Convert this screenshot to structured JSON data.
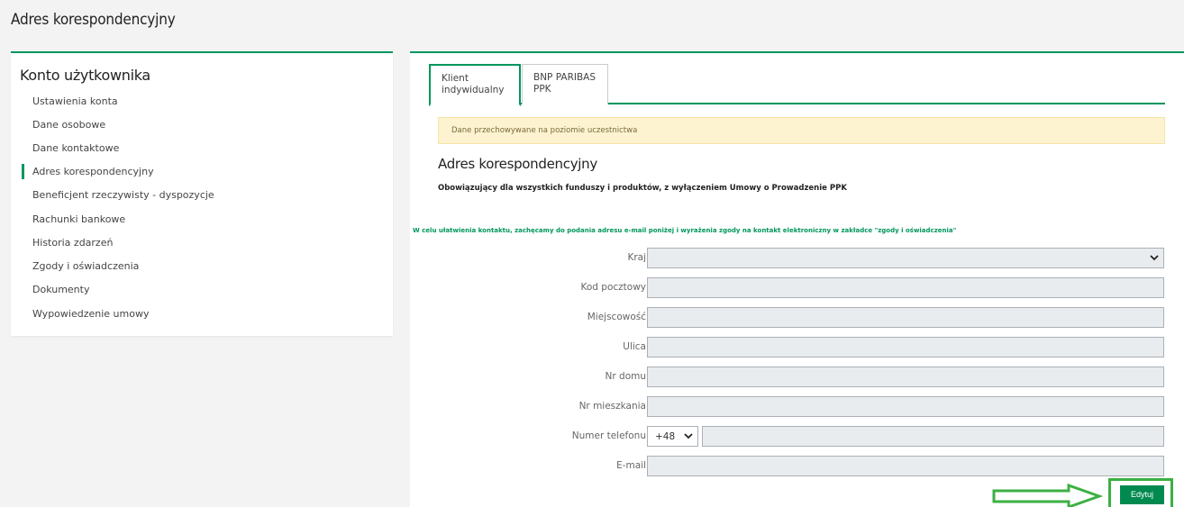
{
  "page": {
    "title": "Adres korespondencyjny"
  },
  "sidebar": {
    "title": "Konto użytkownika",
    "items": [
      {
        "label": "Ustawienia konta"
      },
      {
        "label": "Dane osobowe"
      },
      {
        "label": "Dane kontaktowe"
      },
      {
        "label": "Adres korespondencyjny",
        "active": true
      },
      {
        "label": "Beneficjent rzeczywisty - dyspozycje"
      },
      {
        "label": "Rachunki bankowe"
      },
      {
        "label": "Historia zdarzeń"
      },
      {
        "label": "Zgody i oświadczenia"
      },
      {
        "label": "Dokumenty"
      },
      {
        "label": "Wypowiedzenie umowy"
      }
    ]
  },
  "tabs": [
    {
      "label_line1": "Klient",
      "label_line2": "indywidualny",
      "active": true
    },
    {
      "label_line1": "BNP PARIBAS",
      "label_line2": "PPK",
      "active": false
    }
  ],
  "notice": "Dane przechowywane na poziomie uczestnictwa",
  "section": {
    "title": "Adres korespondencyjny",
    "subtitle": "Obowiązujący dla wszystkich funduszy i produktów, z wyłączeniem Umowy o Prowadzenie PPK",
    "green_note": "W celu ułatwienia kontaktu, zachęcamy do podania adresu e-mail poniżej i wyrażenia zgody na kontakt elektroniczny w zakładce \"zgody i oświadczenia\""
  },
  "form": {
    "country_label": "Kraj",
    "postal_code_label": "Kod pocztowy",
    "city_label": "Miejscowość",
    "street_label": "Ulica",
    "house_no_label": "Nr domu",
    "apartment_no_label": "Nr mieszkania",
    "phone_label": "Numer telefonu",
    "phone_prefix": "+48",
    "email_label": "E-mail"
  },
  "actions": {
    "edit_label": "Edytuj"
  },
  "colors": {
    "accent": "#00965e",
    "notice_bg": "#fdf3d0",
    "annotation": "#3cb043"
  },
  "icons": {
    "dropdown": "chevron-down-icon",
    "arrow": "arrow-right-icon"
  }
}
